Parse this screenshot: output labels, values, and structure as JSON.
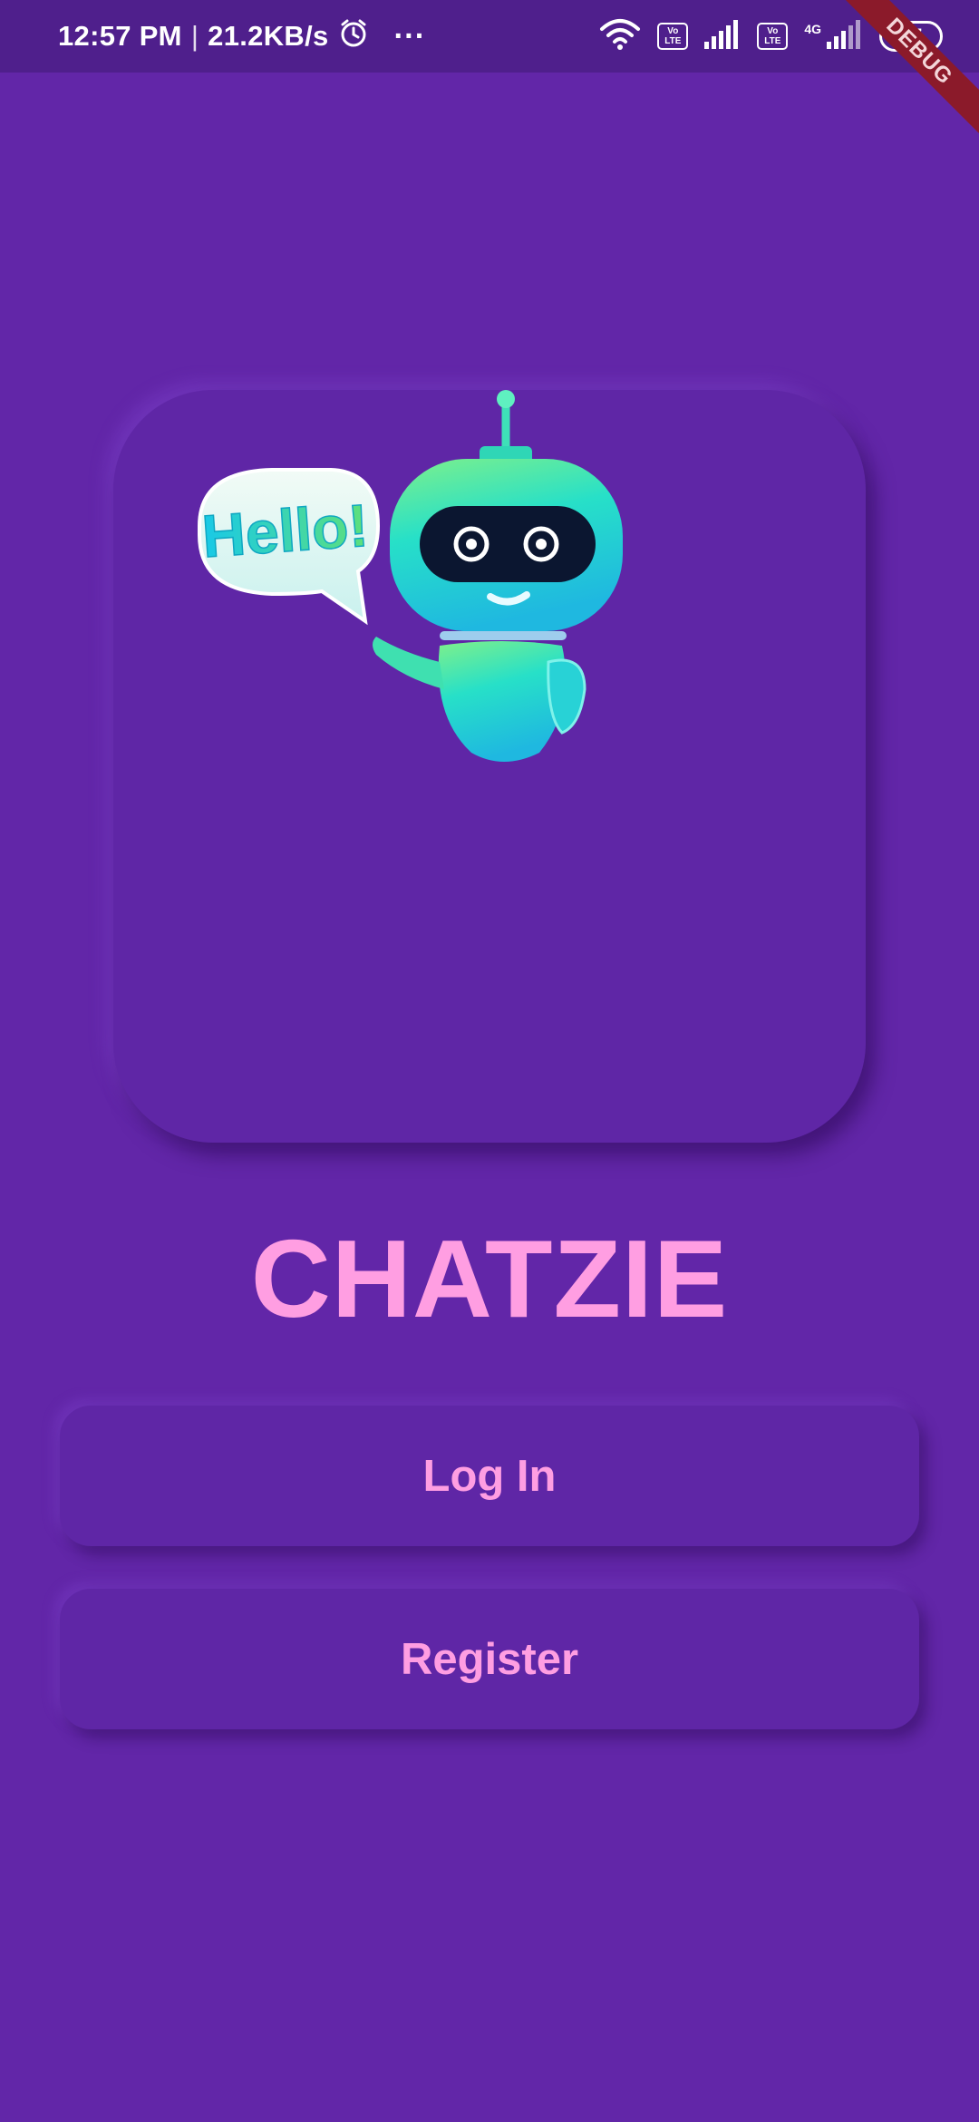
{
  "status_bar": {
    "time": "12:57 PM",
    "separator": "|",
    "speed": "21.2KB/s",
    "more": "···",
    "volte_top": "Vo",
    "volte_bottom": "LTE",
    "network": "4G",
    "battery": "57",
    "debug": "DEBUG"
  },
  "hero": {
    "speech_text": "Hello!"
  },
  "app": {
    "title": "CHATZIE"
  },
  "buttons": {
    "login": "Log In",
    "register": "Register"
  },
  "colors": {
    "background": "#6226a8",
    "status_bar": "#4f1f8c",
    "accent_pink": "#ff9ee2",
    "robot_teal": "#27e0c8",
    "debug_banner": "#8b1a2a"
  }
}
